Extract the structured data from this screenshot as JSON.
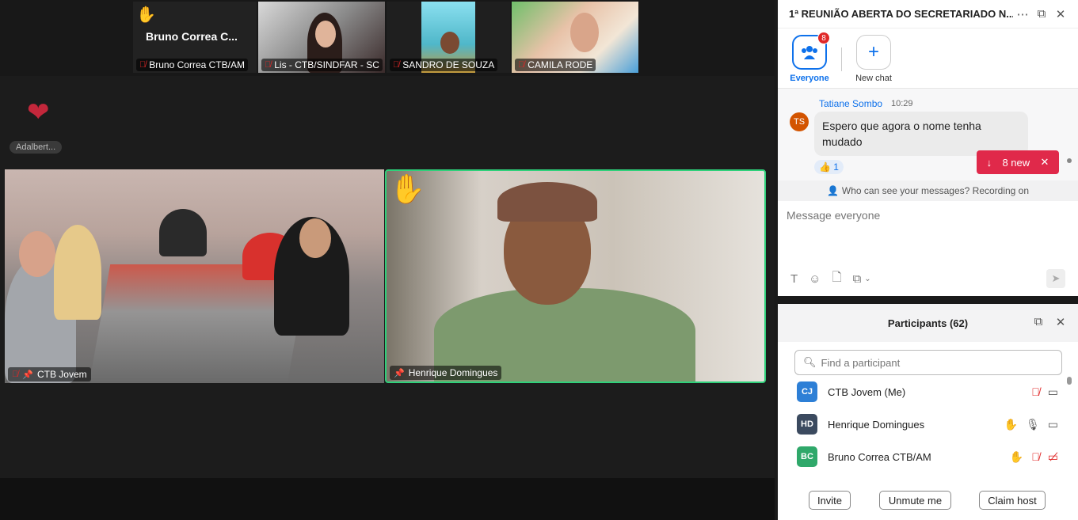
{
  "meeting": {
    "thumbnails": [
      {
        "name": "Bruno Correa CTB/AM",
        "big_name": "Bruno  Correa  C...",
        "hand": "✋"
      },
      {
        "name": "Lis - CTB/SINDFAR - SC"
      },
      {
        "name": "SANDRO DE SOUZA"
      },
      {
        "name": "CAMILA RODE"
      }
    ],
    "reaction_name": "Adalbert...",
    "heart": "❤",
    "tiles": [
      {
        "name": "CTB Jovem"
      },
      {
        "name": "Henrique Domingues",
        "hand": "✋"
      }
    ]
  },
  "chat": {
    "title": "1ª REUNIÃO ABERTA DO SECRETARIADO N...",
    "tabs": [
      {
        "label": "Everyone",
        "badge": "8"
      },
      {
        "label": "New chat"
      }
    ],
    "message": {
      "author": "Tatiane Sombo",
      "time": "10:29",
      "avatar_initials": "TS",
      "text": "Espero que agora o nome tenha mudado",
      "reaction": "👍 1"
    },
    "new_pill": {
      "label": "8 new"
    },
    "who_can_see": "Who can see your messages? Recording on",
    "input_placeholder": "Message everyone"
  },
  "participants": {
    "title": "Participants (62)",
    "search_placeholder": "Find a participant",
    "list": [
      {
        "initials": "CJ",
        "name": "CTB Jovem (Me)",
        "color": "#2d7fd6"
      },
      {
        "initials": "HD",
        "name": "Henrique Domingues",
        "color": "#3b4a5f"
      },
      {
        "initials": "BC",
        "name": "Bruno Correa CTB/AM",
        "color": "#2fa86a"
      }
    ],
    "buttons": {
      "invite": "Invite",
      "unmute": "Unmute me",
      "claim": "Claim host"
    }
  }
}
